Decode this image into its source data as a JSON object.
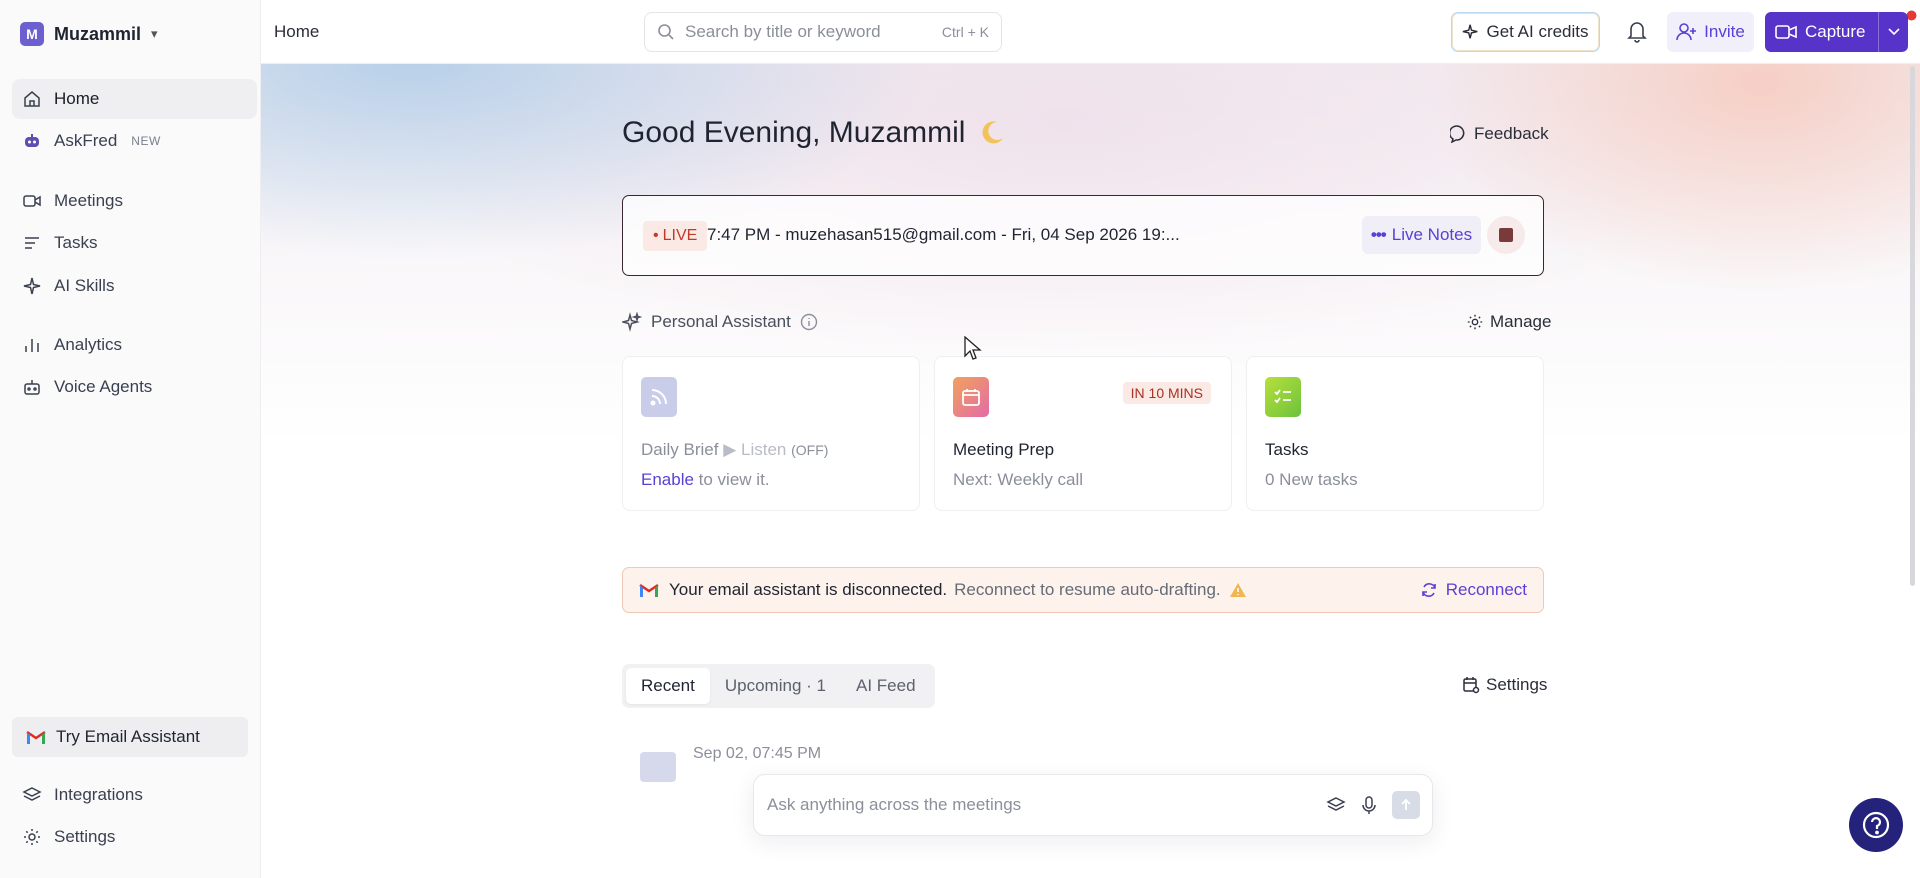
{
  "workspace": {
    "initial": "M",
    "name": "Muzammil"
  },
  "sidebar": {
    "items": [
      {
        "label": "Home",
        "icon": "home-icon"
      },
      {
        "label": "AskFred",
        "badge": "NEW",
        "icon": "bot-icon"
      },
      {
        "label": "Meetings",
        "icon": "video-icon"
      },
      {
        "label": "Tasks",
        "icon": "list-icon"
      },
      {
        "label": "AI Skills",
        "icon": "sparkle-icon"
      },
      {
        "label": "Analytics",
        "icon": "bar-chart-icon"
      },
      {
        "label": "Voice Agents",
        "icon": "robot-icon"
      }
    ],
    "try_email": "Try Email Assistant",
    "bottom": [
      {
        "label": "Integrations",
        "icon": "layers-icon"
      },
      {
        "label": "Settings",
        "icon": "gear-icon"
      }
    ]
  },
  "header": {
    "breadcrumb": "Home",
    "search_placeholder": "Search by title or keyword",
    "search_shortcut": "Ctrl + K",
    "credits_label": "Get AI credits",
    "invite_label": "Invite",
    "capture_label": "Capture"
  },
  "main": {
    "greeting": "Good Evening, Muzammil",
    "feedback_label": "Feedback",
    "live": {
      "tag": "LIVE",
      "text": "7:47 PM - muzehasan515@gmail.com - Fri, 04 Sep 2026 19:...",
      "notes_label": "Live Notes"
    },
    "assistant": {
      "title": "Personal Assistant",
      "manage_label": "Manage"
    },
    "cards": [
      {
        "title": "Daily Brief",
        "listen": "Listen",
        "listen_state": "(OFF)",
        "enable": "Enable",
        "sub_rest": " to view it."
      },
      {
        "title": "Meeting Prep",
        "badge": "IN 10 MINS",
        "sub": "Next: Weekly call"
      },
      {
        "title": "Tasks",
        "sub": "0 New tasks"
      }
    ],
    "alert": {
      "strong": "Your email assistant is disconnected.",
      "rest": "Reconnect to resume auto-drafting.",
      "action": "Reconnect"
    },
    "tabs": [
      "Recent",
      "Upcoming · 1",
      "AI Feed"
    ],
    "settings_label": "Settings",
    "recent_date": "Sep 02, 07:45 PM",
    "ask_placeholder": "Ask anything across the meetings"
  },
  "colors": {
    "accent": "#5733c9",
    "live_red": "#c2392b",
    "help_bg": "#24227a"
  }
}
